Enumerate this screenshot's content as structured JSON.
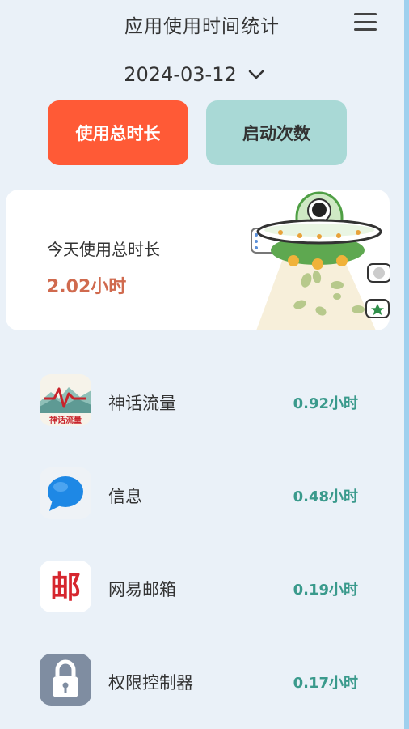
{
  "header": {
    "title": "应用使用时间统计",
    "menu_icon": "hamburger-menu-icon"
  },
  "date": {
    "value": "2024-03-12",
    "icon": "chevron-down-icon"
  },
  "tabs": [
    {
      "label": "使用总时长",
      "active": true
    },
    {
      "label": "启动次数",
      "active": false
    }
  ],
  "summary": {
    "label": "今天使用总时长",
    "value": "2.02小时"
  },
  "apps": [
    {
      "name": "神话流量",
      "time": "0.92小时",
      "icon": "mythic-traffic-app-icon",
      "icon_text": "神话流量"
    },
    {
      "name": "信息",
      "time": "0.48小时",
      "icon": "messages-app-icon"
    },
    {
      "name": "网易邮箱",
      "time": "0.19小时",
      "icon": "netease-mail-app-icon",
      "icon_text": "邮"
    },
    {
      "name": "权限控制器",
      "time": "0.17小时",
      "icon": "permission-controller-app-icon"
    }
  ],
  "colors": {
    "background": "#eaf1f8",
    "active_tab": "#ff5a36",
    "inactive_tab": "#a9d9d6",
    "summary_value": "#d06a4e",
    "app_time": "#3a9a8c"
  }
}
